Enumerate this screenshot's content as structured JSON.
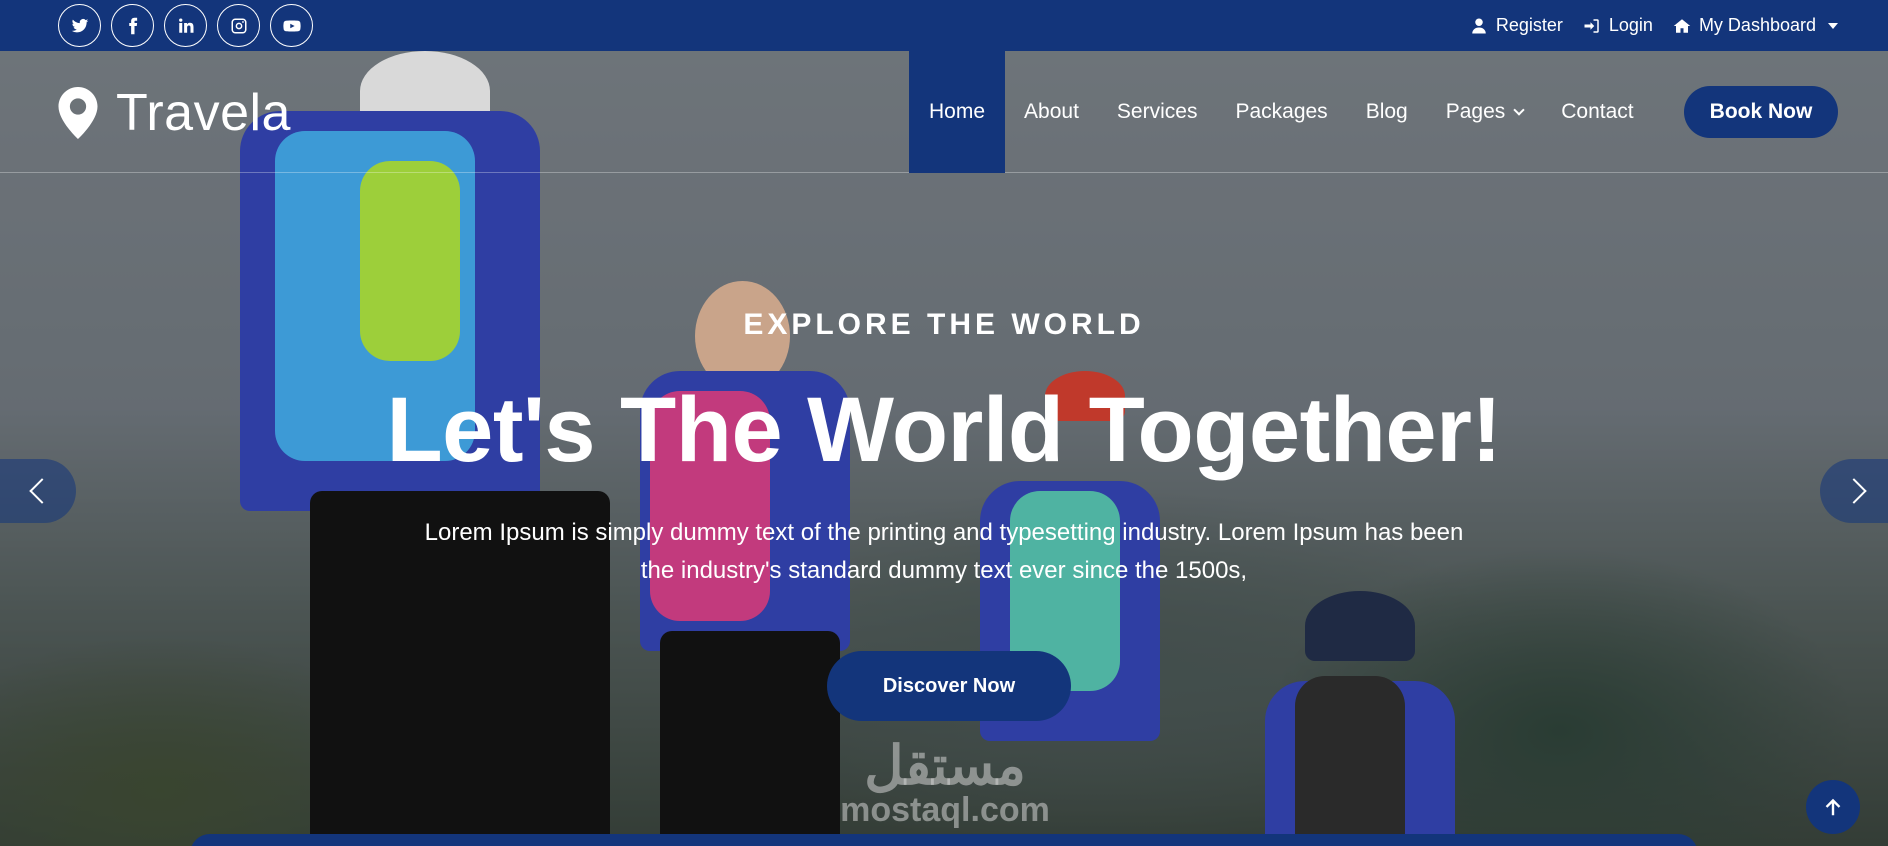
{
  "topbar": {
    "socials": [
      "twitter-icon",
      "facebook-icon",
      "linkedin-icon",
      "instagram-icon",
      "youtube-icon"
    ],
    "register_label": "Register",
    "login_label": "Login",
    "dashboard_label": "My Dashboard"
  },
  "brand": {
    "name": "Travela"
  },
  "nav": {
    "items": [
      {
        "label": "Home",
        "active": true
      },
      {
        "label": "About"
      },
      {
        "label": "Services"
      },
      {
        "label": "Packages"
      },
      {
        "label": "Blog"
      },
      {
        "label": "Pages",
        "has_dropdown": true
      },
      {
        "label": "Contact"
      }
    ],
    "book_label": "Book Now"
  },
  "hero": {
    "eyebrow": "EXPLORE THE WORLD",
    "headline": "Let's The World Together!",
    "subtext": "Lorem Ipsum is simply dummy text of the printing and typesetting industry. Lorem Ipsum has been the industry's standard dummy text ever since the 1500s,",
    "cta_label": "Discover Now"
  },
  "watermark": {
    "arabic": "مستقل",
    "latin": "mostaql.com"
  },
  "colors": {
    "primary": "#13357b",
    "text": "#ffffff"
  }
}
